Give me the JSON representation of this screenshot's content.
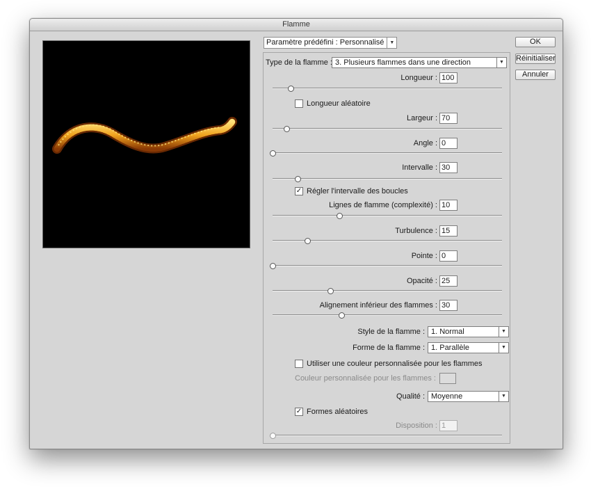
{
  "window": {
    "title": "Flamme"
  },
  "preset": {
    "label": "Paramètre prédéfini : Personnalisé"
  },
  "buttons": {
    "ok": "OK",
    "reset": "Réinitialiser",
    "cancel": "Annuler"
  },
  "flame_type": {
    "label": "Type de la flamme :",
    "value": "3. Plusieurs flammes dans une direction"
  },
  "params": {
    "longueur": {
      "label": "Longueur :",
      "value": "100",
      "slider": 0.08
    },
    "longueur_aleatoire": {
      "label": "Longueur aléatoire",
      "checked": false
    },
    "largeur": {
      "label": "Largeur :",
      "value": "70",
      "slider": 0.06
    },
    "angle": {
      "label": "Angle :",
      "value": "0",
      "slider": 0.0
    },
    "intervalle": {
      "label": "Intervalle :",
      "value": "30",
      "slider": 0.11
    },
    "regler_intervalle": {
      "label": "Régler l'intervalle des boucles",
      "checked": true
    },
    "lignes": {
      "label": "Lignes de flamme (complexité) :",
      "value": "10",
      "slider": 0.29
    },
    "turbulence": {
      "label": "Turbulence :",
      "value": "15",
      "slider": 0.15
    },
    "pointe": {
      "label": "Pointe :",
      "value": "0",
      "slider": 0.0
    },
    "opacite": {
      "label": "Opacité :",
      "value": "25",
      "slider": 0.25
    },
    "alignement": {
      "label": "Alignement inférieur des flammes :",
      "value": "30",
      "slider": 0.3
    }
  },
  "style": {
    "label": "Style de la flamme :",
    "value": "1. Normal"
  },
  "forme": {
    "label": "Forme de la flamme :",
    "value": "1. Parallèle"
  },
  "custom_color": {
    "label": "Utiliser une couleur personnalisée pour les flammes",
    "checked": false,
    "color_label": "Couleur personnalisée pour les flammes :"
  },
  "qualite": {
    "label": "Qualité :",
    "value": "Moyenne"
  },
  "formes_aleatoires": {
    "label": "Formes aléatoires",
    "checked": true
  },
  "disposition": {
    "label": "Disposition :",
    "value": "1",
    "slider": 0.0
  },
  "icons": {
    "dropdown": "chevron-down-icon",
    "check": "checkmark-icon"
  },
  "colors": {
    "flame": "#f0a21e",
    "flame_core": "#ffe27a",
    "background": "#000000"
  }
}
